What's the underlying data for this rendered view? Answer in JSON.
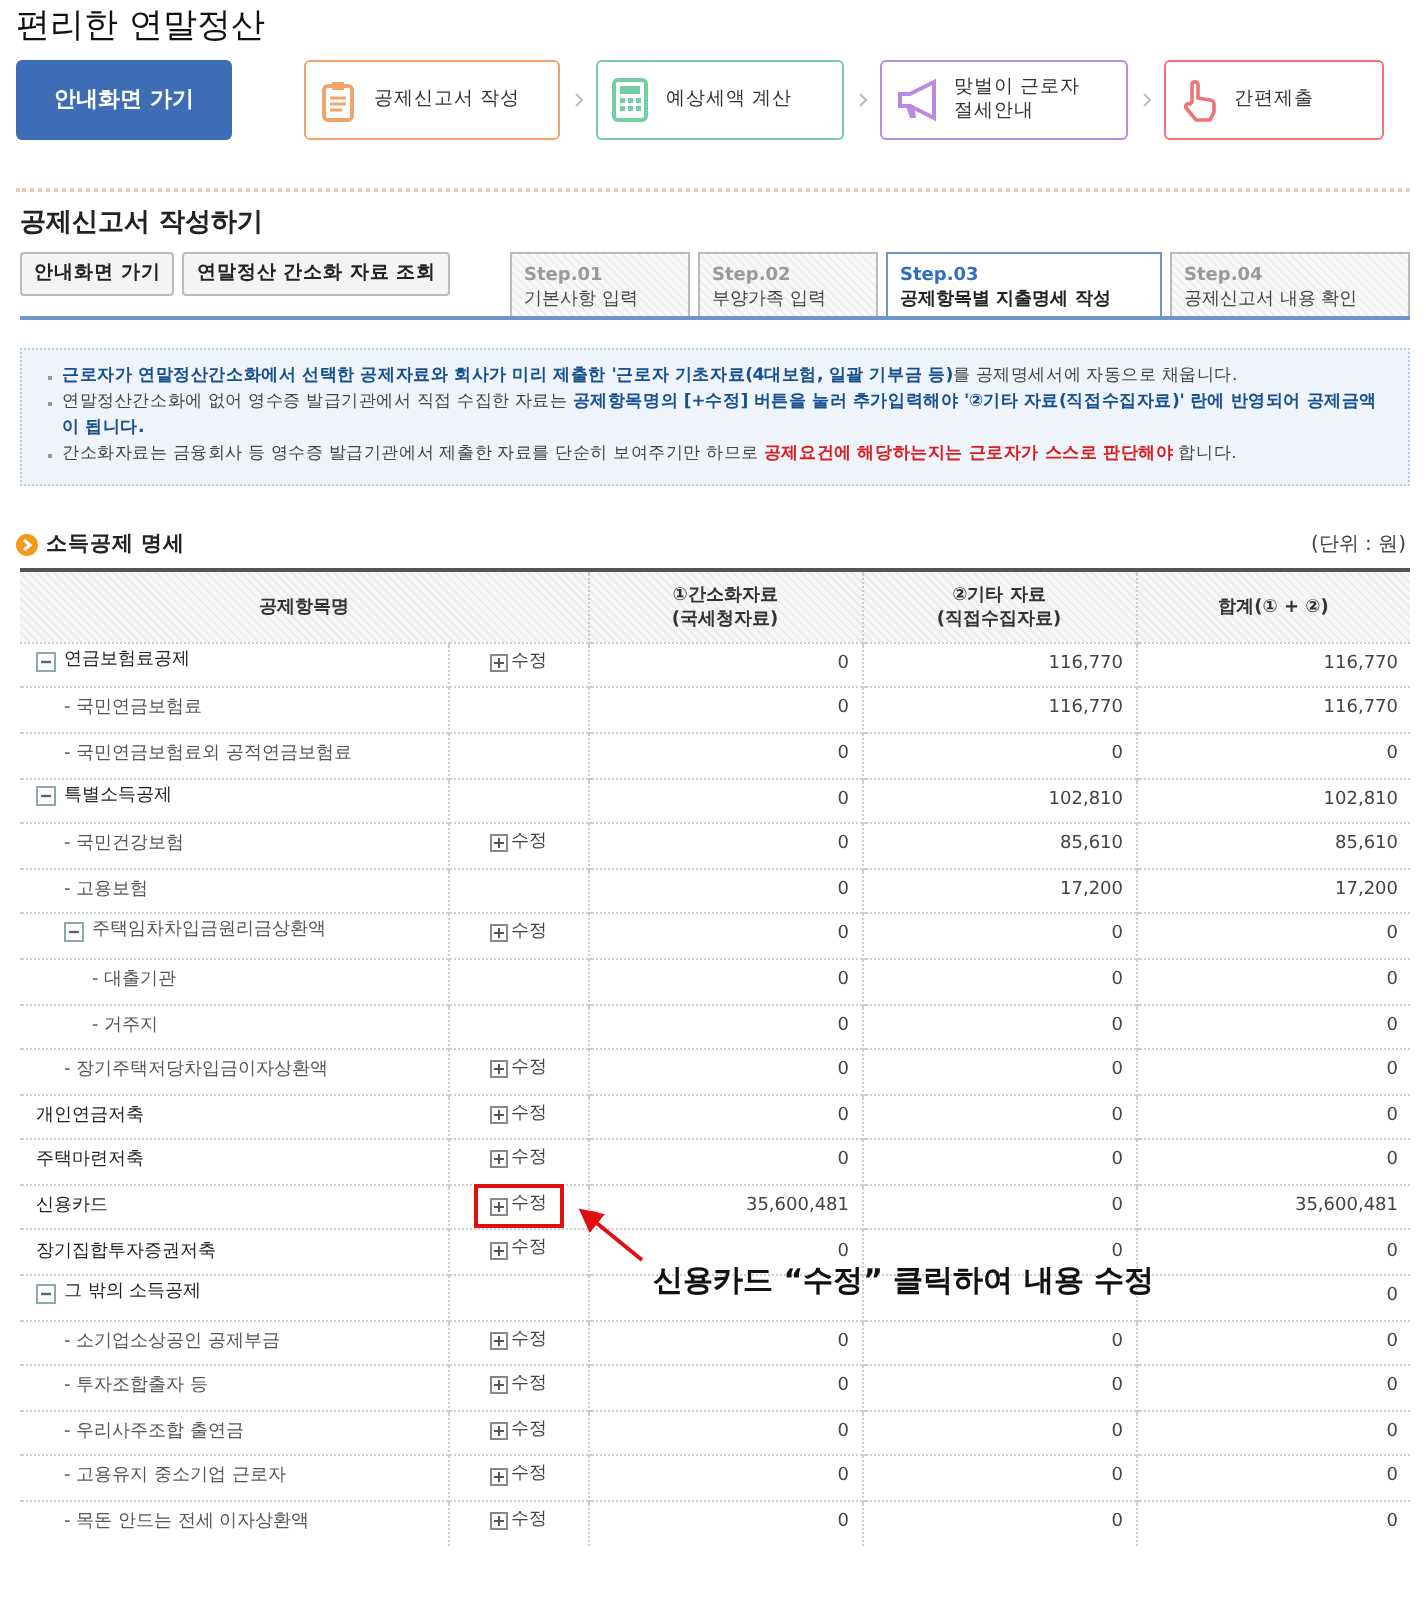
{
  "page_title": "편리한 연말정산",
  "home_button": "안내화면 가기",
  "flow_steps": [
    {
      "label": "공제신고서 작성",
      "kind": "clipboard",
      "color": "#f4a46a"
    },
    {
      "label": "예상세액 계산",
      "kind": "calculator",
      "color": "#74cfa0"
    },
    {
      "label": "맞벌이 근로자\n절세안내",
      "kind": "megaphone",
      "color": "#b88ae2"
    },
    {
      "label": "간편제출",
      "kind": "hand",
      "color": "#f07474"
    }
  ],
  "section_title": "공제신고서 작성하기",
  "action_buttons": [
    "안내화면 가기",
    "연말정산 간소화 자료 조회"
  ],
  "step_tabs": [
    {
      "step": "Step.01",
      "label": "기본사항 입력",
      "selected": false
    },
    {
      "step": "Step.02",
      "label": "부양가족 입력",
      "selected": false
    },
    {
      "step": "Step.03",
      "label": "공제항목별 지출명세 작성",
      "selected": true
    },
    {
      "step": "Step.04",
      "label": "공제신고서 내용 확인",
      "selected": false
    }
  ],
  "notices": [
    [
      {
        "text": "근로자가 연말정산간소화에서 선택한 공제자료와 회사가 미리 제출한 '근로자 기초자료(4대보험, 일괄 기부금 등)",
        "kind": "blue"
      },
      {
        "text": "를 공제명세서에 자동으로 채웁니다.",
        "kind": "plain"
      }
    ],
    [
      {
        "text": "연말정산간소화에 없어 영수증 발급기관에서 직접 수집한 자료는 ",
        "kind": "plain"
      },
      {
        "text": "공제항목명의 [+수정] 버튼을 눌러 추가입력해야 '②기타 자료(직접수집자료)' 란에 반영되어 공제금액이 됩니다.",
        "kind": "blue"
      }
    ],
    [
      {
        "text": "간소화자료는 금융회사 등 영수증 발급기관에서 제출한 자료를 단순히 보여주기만 하므로 ",
        "kind": "plain"
      },
      {
        "text": "공제요건에 해당하는지는 근로자가 스스로 판단해야",
        "kind": "red"
      },
      {
        "text": " 합니다.",
        "kind": "plain"
      }
    ]
  ],
  "table_title": "소득공제 명세",
  "unit": "(단위 : 원)",
  "table": {
    "columns": [
      "공제항목명",
      "①간소화자료\n(국세청자료)",
      "②기타 자료\n(직접수집자료)",
      "합계(① + ②)"
    ],
    "rows": [
      {
        "name": "연금보험료공제",
        "expanded": true,
        "edit": "수정",
        "values": [
          "0",
          "116,770",
          "116,770"
        ],
        "children": [
          {
            "name": "- 국민연금보험료",
            "values": [
              "0",
              "116,770",
              "116,770"
            ]
          },
          {
            "name": "- 국민연금보험료외 공적연금보험료",
            "values": [
              "0",
              "0",
              "0"
            ]
          }
        ]
      },
      {
        "name": "특별소득공제",
        "expanded": true,
        "values": [
          "0",
          "102,810",
          "102,810"
        ],
        "children": [
          {
            "name": "- 국민건강보험",
            "edit": "수정",
            "values": [
              "0",
              "85,610",
              "85,610"
            ]
          },
          {
            "name": "- 고용보험",
            "values": [
              "0",
              "17,200",
              "17,200"
            ]
          },
          {
            "name": "주택임차차입금원리금상환액",
            "expanded": true,
            "edit": "수정",
            "values": [
              "0",
              "0",
              "0"
            ],
            "children": [
              {
                "name": "- 대출기관",
                "values": [
                  "0",
                  "0",
                  "0"
                ]
              },
              {
                "name": "- 거주지",
                "values": [
                  "0",
                  "0",
                  "0"
                ]
              }
            ]
          },
          {
            "name": "- 장기주택저당차입금이자상환액",
            "edit": "수정",
            "values": [
              "0",
              "0",
              "0"
            ]
          }
        ]
      },
      {
        "name": "개인연금저축",
        "edit": "수정",
        "values": [
          "0",
          "0",
          "0"
        ]
      },
      {
        "name": "주택마련저축",
        "edit": "수정",
        "values": [
          "0",
          "0",
          "0"
        ]
      },
      {
        "name": "신용카드",
        "edit": "수정",
        "highlighted": true,
        "values": [
          "35,600,481",
          "0",
          "35,600,481"
        ]
      },
      {
        "name": "장기집합투자증권저축",
        "edit": "수정",
        "values": [
          "0",
          "0",
          "0"
        ]
      },
      {
        "name": "그 밖의 소득공제",
        "expanded": true,
        "total_only": "0",
        "children": [
          {
            "name": "- 소기업소상공인 공제부금",
            "edit": "수정",
            "values": [
              "0",
              "0",
              "0"
            ]
          },
          {
            "name": "- 투자조합출자 등",
            "edit": "수정",
            "values": [
              "0",
              "0",
              "0"
            ]
          },
          {
            "name": "- 우리사주조합 출연금",
            "edit": "수정",
            "values": [
              "0",
              "0",
              "0"
            ]
          },
          {
            "name": "- 고용유지 중소기업 근로자",
            "edit": "수정",
            "values": [
              "0",
              "0",
              "0"
            ]
          },
          {
            "name": "- 목돈 안드는 전세 이자상환액",
            "edit": "수정",
            "values": [
              "0",
              "0",
              "0"
            ]
          }
        ]
      }
    ]
  },
  "annotation": "신용카드 “수정” 클릭하여 내용 수정"
}
